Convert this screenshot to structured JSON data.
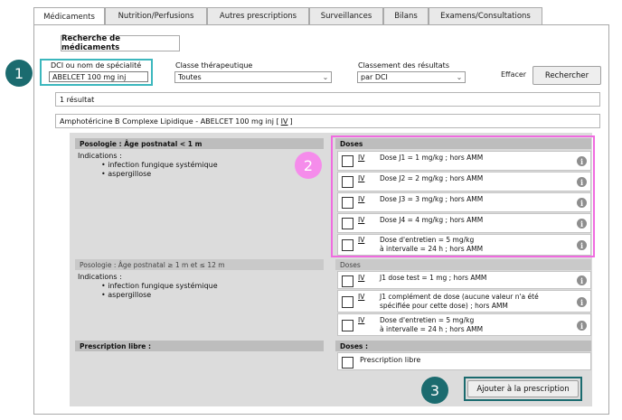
{
  "tabs": [
    {
      "label": "Médicaments",
      "active": true
    },
    {
      "label": "Nutrition/Perfusions",
      "active": false
    },
    {
      "label": "Autres prescriptions",
      "active": false
    },
    {
      "label": "Surveillances",
      "active": false
    },
    {
      "label": "Bilans",
      "active": false
    },
    {
      "label": "Examens/Consultations",
      "active": false
    }
  ],
  "search": {
    "section_title": "Recherche de médicaments",
    "dci_label": "DCI ou nom de spécialité",
    "dci_value": "ABELCET 100 mg inj",
    "class_label": "Classe thérapeutique",
    "class_value": "Toutes",
    "sort_label": "Classement des résultats",
    "sort_value": "par DCI",
    "clear_label": "Effacer",
    "search_button": "Rechercher"
  },
  "results": {
    "count_text": "1 résultat",
    "item": "Amphotéricine B Complexe Lipidique - ABELCET 100 mg inj [",
    "route": "IV",
    "item_end": "]"
  },
  "posologies": [
    {
      "title": "Posologie : Âge postnatal < 1 m",
      "indications_label": "Indications :",
      "indications": [
        "• infection fungique systémique",
        "• aspergillose"
      ],
      "doses_label": "Doses",
      "doses": [
        {
          "route": "IV",
          "text": [
            "Dose J1 = 1 mg/kg ; hors AMM"
          ]
        },
        {
          "route": "IV",
          "text": [
            "Dose J2 = 2 mg/kg ; hors AMM"
          ]
        },
        {
          "route": "IV",
          "text": [
            "Dose J3 = 3 mg/kg ; hors AMM"
          ]
        },
        {
          "route": "IV",
          "text": [
            "Dose J4 = 4 mg/kg ; hors AMM"
          ]
        },
        {
          "route": "IV",
          "text": [
            "Dose d'entretien = 5 mg/kg",
            "à intervalle = 24 h ; hors AMM"
          ]
        }
      ]
    },
    {
      "title": "Posologie : Âge postnatal ≥ 1 m et ≤ 12 m",
      "indications_label": "Indications :",
      "indications": [
        "• infection fungique systémique",
        "• aspergillose"
      ],
      "doses_label": "Doses",
      "doses": [
        {
          "route": "IV",
          "text": [
            "J1 dose test = 1 mg ; hors AMM"
          ]
        },
        {
          "route": "IV",
          "text": [
            "J1 complément de dose (aucune valeur n'a été",
            "spécifiée pour cette dose) ; hors AMM"
          ]
        },
        {
          "route": "IV",
          "text": [
            "Dose d'entretien = 5 mg/kg",
            "à intervalle = 24 h ; hors AMM"
          ]
        }
      ]
    }
  ],
  "free": {
    "title": "Prescription libre :",
    "doses_label": "Doses :",
    "option": "Prescription libre"
  },
  "add_button": "Ajouter à la prescription",
  "markers": [
    "1",
    "2",
    "3"
  ],
  "colors": {
    "marker_teal": "#1b6b6f",
    "highlight_teal": "#3cb7bd",
    "highlight_pink": "#f06be0",
    "marker_pink": "#f58ceb",
    "info_grey": "#8e8e8e"
  },
  "icons": {
    "info": "i",
    "chevron": "⌄"
  }
}
